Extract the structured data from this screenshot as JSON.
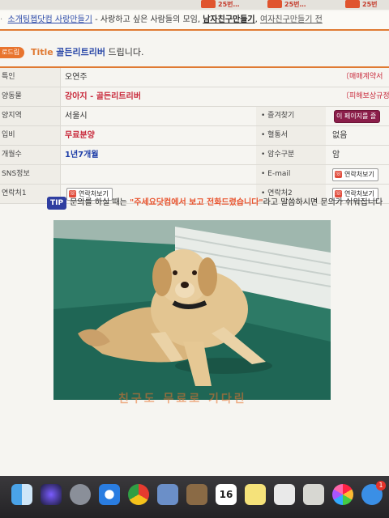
{
  "top_tabs": [
    "25번…",
    "25번…",
    "25번"
  ],
  "link_bar": {
    "link1": "소개팅쳅닷컴 사랑만들기",
    "text1": " - 사랑하고 싶은 사람들의 모임,",
    "link2": "남자친구만들기",
    "sep": ",",
    "link3": "여자친구만들기 전"
  },
  "title": {
    "badge": "로드림",
    "label": "Title",
    "name": "골든리트리버",
    "suffix": "드립니다."
  },
  "rows": [
    {
      "label": "특인",
      "value": "오연주",
      "right_link": "〔매매계약서"
    },
    {
      "label": "양동물",
      "value": "강아지 - 골든리트리버",
      "right_link": "〔피해보상규정"
    },
    {
      "label": "양지역",
      "value": "서울시",
      "label2": "즐겨찾기",
      "button2": "이 페이지를 즐"
    },
    {
      "label": "입비",
      "value": "무료분양",
      "label2": "혈통서",
      "value2": "없음"
    },
    {
      "label": "개월수",
      "value": "1년7개월",
      "label2": "암수구분",
      "value2": "암"
    },
    {
      "label": "SNS정보",
      "value": "",
      "label2": "E-mail",
      "button2": "연락처보기"
    },
    {
      "label": "연락처1",
      "button": "연락처보기",
      "label2": "연락처2",
      "button2": "연락처보기"
    }
  ],
  "tip": {
    "badge": "TIP",
    "pre": "문의를 하실 때는 ",
    "highlight": "\"주세요닷컴에서 보고 전화드렸습니다\"",
    "post": "라고 말씀하시면 문의가 쉬워집니다"
  },
  "photo_caption": "친구도 무료로 기다린",
  "dock": {
    "calendar_day": "16",
    "notification_badge": "1"
  },
  "colors": {
    "accent_orange": "#e07a33",
    "link_blue": "#2a48a8",
    "red_value": "#c8283a",
    "tip_blue": "#2f3ea0"
  }
}
